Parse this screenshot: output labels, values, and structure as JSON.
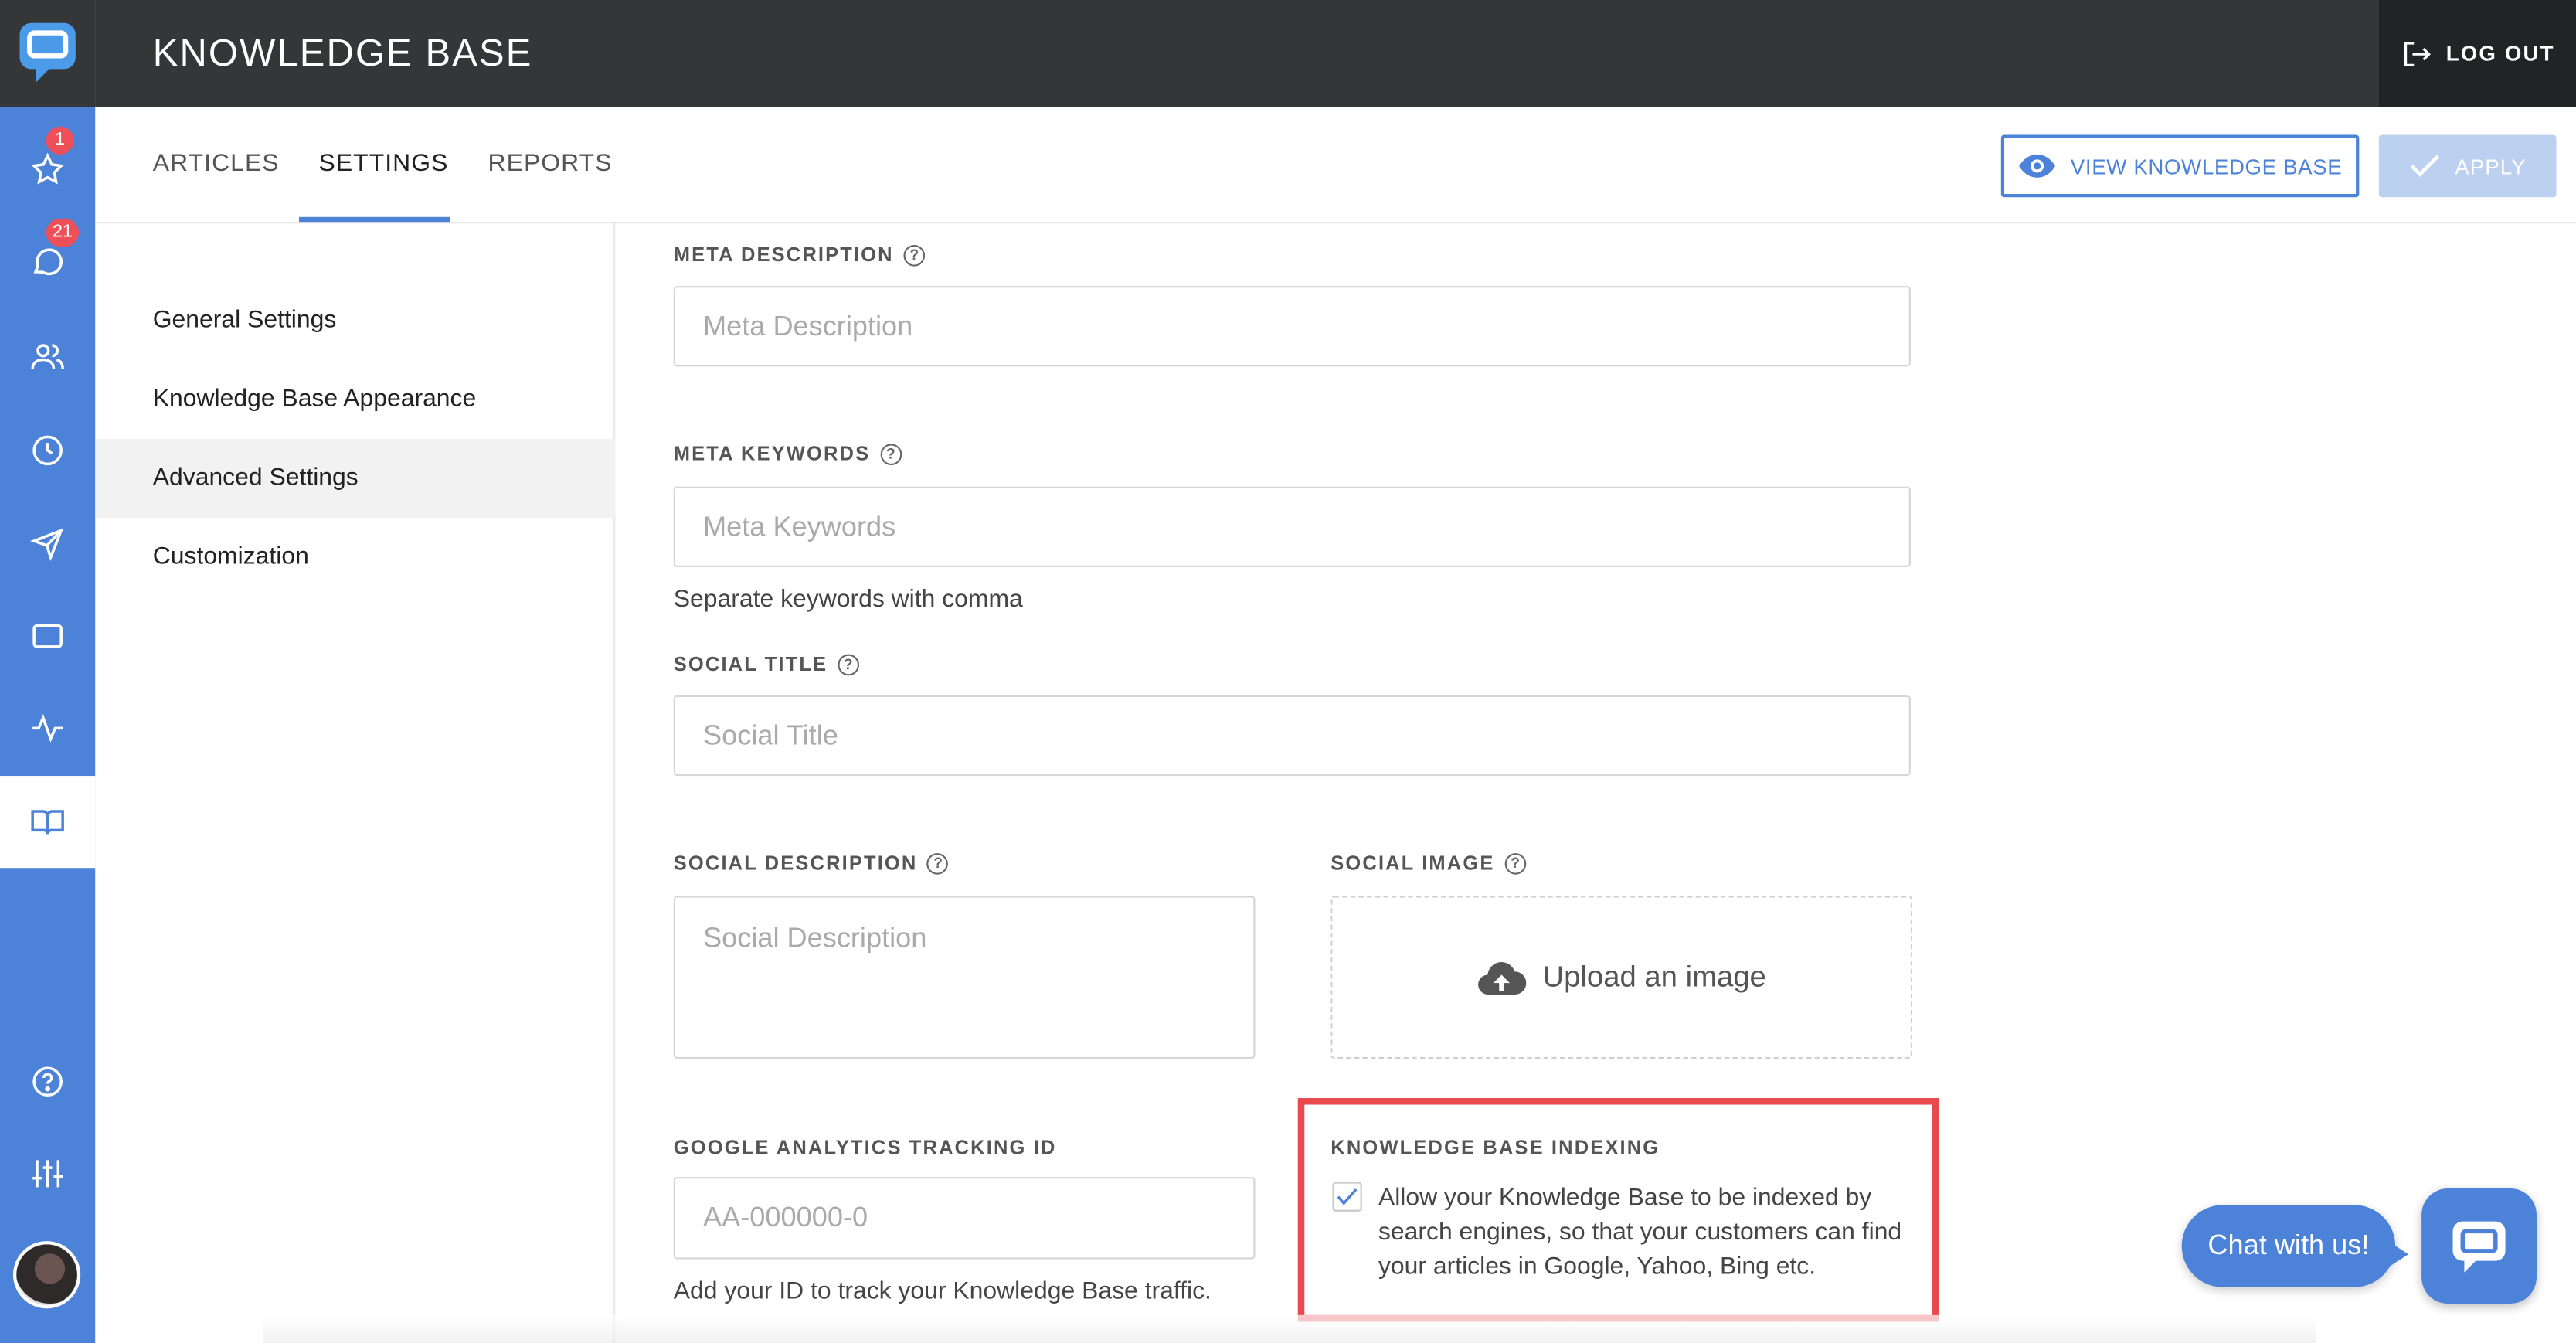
{
  "app": {
    "title": "KNOWLEDGE BASE",
    "logout_label": "LOG OUT"
  },
  "rail": {
    "icons": [
      "chat-logo-icon",
      "star-icon",
      "chat-icon",
      "users-icon",
      "clock-icon",
      "send-icon",
      "window-icon",
      "activity-icon",
      "book-icon",
      "help-icon",
      "sliders-icon"
    ],
    "badges": {
      "starred": "1",
      "chats": "21"
    },
    "accent": "#4c82d8"
  },
  "tabs": [
    {
      "label": "ARTICLES"
    },
    {
      "label": "SETTINGS",
      "active": true
    },
    {
      "label": "REPORTS"
    }
  ],
  "actions": {
    "view_kb_label": "VIEW KNOWLEDGE BASE",
    "apply_label": "APPLY",
    "apply_disabled": true
  },
  "submenu": [
    {
      "label": "General Settings"
    },
    {
      "label": "Knowledge Base Appearance"
    },
    {
      "label": "Advanced Settings",
      "active": true
    },
    {
      "label": "Customization"
    }
  ],
  "form": {
    "meta_description": {
      "label": "META DESCRIPTION",
      "placeholder": "Meta Description",
      "value": ""
    },
    "meta_keywords": {
      "label": "META KEYWORDS",
      "placeholder": "Meta Keywords",
      "value": "",
      "hint": "Separate keywords with comma"
    },
    "social_title": {
      "label": "SOCIAL TITLE",
      "placeholder": "Social Title",
      "value": ""
    },
    "social_description": {
      "label": "SOCIAL DESCRIPTION",
      "placeholder": "Social Description",
      "value": ""
    },
    "social_image": {
      "label": "SOCIAL IMAGE",
      "upload_label": "Upload an image"
    },
    "ga_tracking": {
      "label": "GOOGLE ANALYTICS TRACKING ID",
      "placeholder": "AA-000000-0",
      "value": "",
      "hint": "Add your ID to track your Knowledge Base traffic."
    },
    "indexing": {
      "label": "KNOWLEDGE BASE INDEXING",
      "checked": true,
      "text": "Allow your Knowledge Base to be indexed by search engines, so that your customers can find your articles in Google, Yahoo, Bing etc.",
      "highlight_color": "#e8494f"
    }
  },
  "chat_widget": {
    "label": "Chat with us!"
  }
}
